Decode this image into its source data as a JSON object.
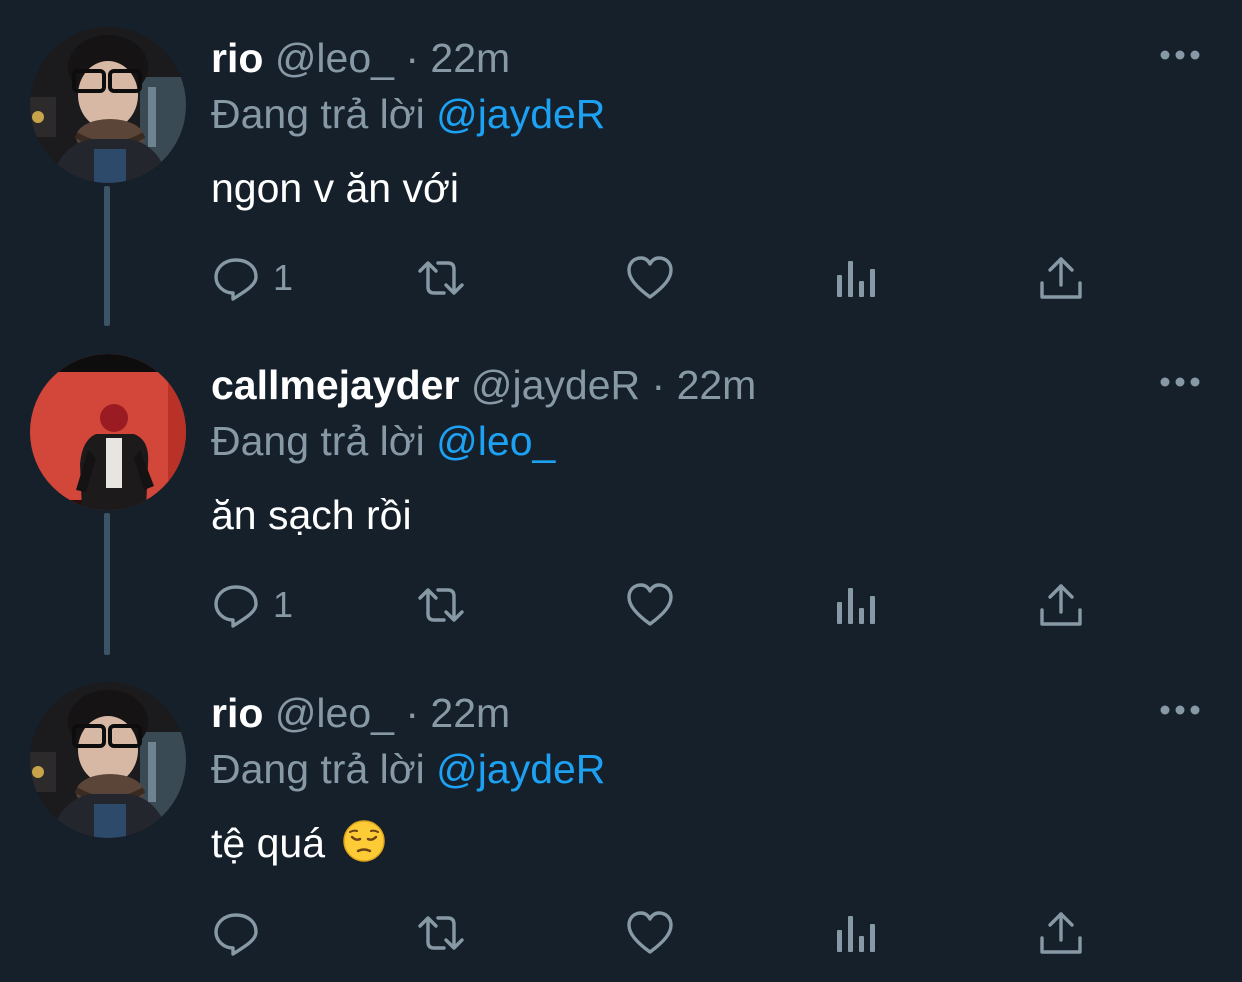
{
  "tweets": [
    {
      "display_name": "rio",
      "handle": "@leo_",
      "separator": "·",
      "time": "22m",
      "reply_prefix": "Đang trả lời",
      "reply_to": "@jaydeR",
      "text": "ngon v ăn với",
      "reply_count": "1",
      "avatar": "rio-avatar"
    },
    {
      "display_name": "callmejayder",
      "handle": "@jaydeR",
      "separator": "·",
      "time": "22m",
      "reply_prefix": "Đang trả lời",
      "reply_to": "@leo_",
      "text": "ăn sạch rồi",
      "reply_count": "1",
      "avatar": "callmejayder-avatar"
    },
    {
      "display_name": "rio",
      "handle": "@leo_",
      "separator": "·",
      "time": "22m",
      "reply_prefix": "Đang trả lời",
      "reply_to": "@jaydeR",
      "text": "tệ quá",
      "text_emoji": "pensive-face-emoji",
      "reply_count": "",
      "avatar": "rio-avatar"
    }
  ],
  "icons": [
    "reply-icon",
    "retweet-icon",
    "like-icon",
    "analytics-icon",
    "share-icon",
    "more-icon"
  ],
  "colors": {
    "background": "#15202b",
    "text_primary": "#ffffff",
    "text_secondary": "#8899a6",
    "accent": "#1da1f2",
    "thread_line": "#3d5466"
  }
}
